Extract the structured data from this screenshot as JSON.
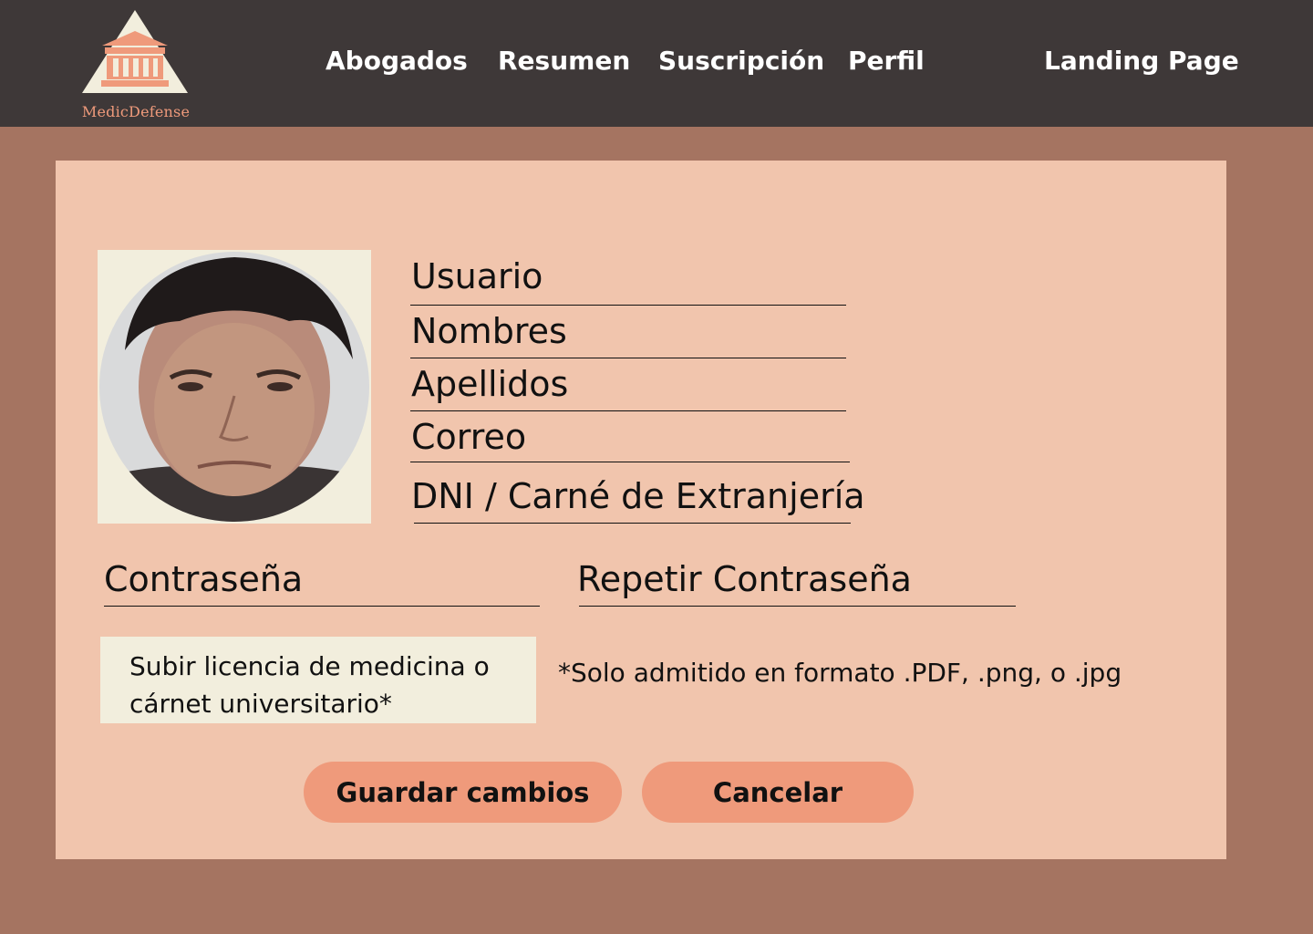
{
  "brand": {
    "name": "MedicDefense",
    "icon": "courthouse-icon"
  },
  "nav": {
    "items": [
      {
        "label": "Abogados"
      },
      {
        "label": "Resumen"
      },
      {
        "label": "Suscripción"
      },
      {
        "label": "Perfil"
      },
      {
        "label": "Landing Page"
      }
    ]
  },
  "profile": {
    "photo": "user-avatar-photo",
    "fields": {
      "usuario": "Usuario",
      "nombres": "Nombres",
      "apellidos": "Apellidos",
      "correo": "Correo",
      "dni": "DNI / Carné de Extranjería",
      "password": "Contraseña",
      "repeat_password": "Repetir Contraseña"
    },
    "upload_label_line1": "Subir licencia de medicina o",
    "upload_label_line2": "cárnet universitario*",
    "upload_note": "*Solo admitido en formato .PDF, .png, o .jpg"
  },
  "actions": {
    "save_label": "Guardar cambios",
    "cancel_label": "Cancelar"
  },
  "colors": {
    "navbar": "#3e3838",
    "background": "#a57461",
    "card": "#f1c5ad",
    "accent": "#ef9a7b",
    "panel": "#f2eedd"
  }
}
